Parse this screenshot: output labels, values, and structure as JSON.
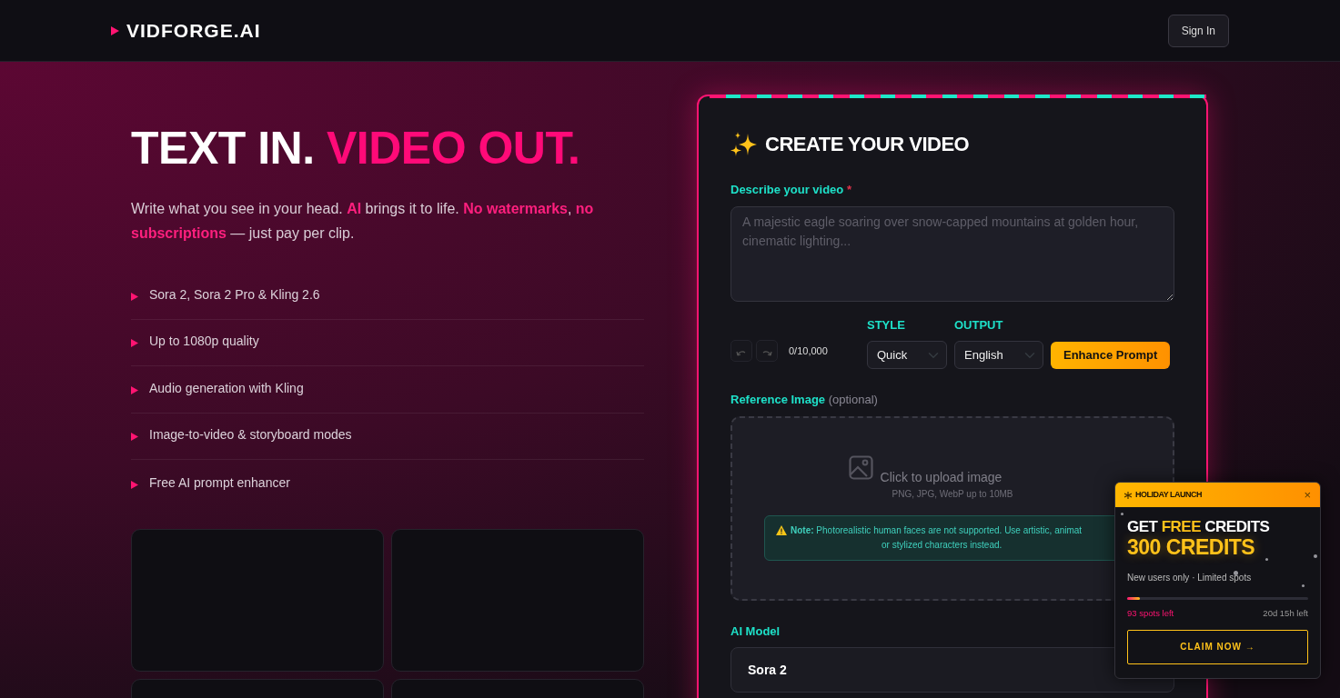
{
  "brand": {
    "name": "VIDFORGE.AI"
  },
  "nav": {
    "sign_in": "Sign In"
  },
  "hero": {
    "title_white": "TEXT IN.",
    "title_accent": "VIDEO OUT.",
    "intro": "Write what you see in your head. **AI** brings it to life. **No watermarks**, **no subscriptions** — just pay per clip.",
    "features": [
      "Sora 2, Sora 2 Pro & Kling 2.6",
      "Up to 1080p quality",
      "Audio generation with Kling",
      "Image-to-video & storyboard modes",
      "Free AI prompt enhancer"
    ]
  },
  "form": {
    "title": "CREATE YOUR VIDEO",
    "prompt_label": "Describe your video",
    "required_mark": "*",
    "prompt_placeholder": "A majestic eagle soaring over snow-capped mountains at golden hour, cinematic lighting...",
    "char_count": "0/10,000",
    "style": {
      "label": "STYLE",
      "value": "Quick"
    },
    "output": {
      "label": "OUTPUT",
      "value": "English"
    },
    "enhance_button": "Enhance Prompt",
    "reference_label": "Reference Image",
    "reference_hint": "(optional)",
    "upload_text": "Click to upload image",
    "upload_formats": "PNG, JPG, WebP up to 10MB",
    "note_label": "Note:",
    "note_lines": [
      "Photorealistic human faces are not supported. Use artistic, animat",
      "or stylized characters instead."
    ],
    "model_label": "AI Model",
    "model_value": "Sora 2"
  },
  "promo": {
    "header": "HOLIDAY LAUNCH",
    "close": "×",
    "headline_white_1": "GET",
    "headline_accent": "FREE",
    "headline_white_2": "CREDITS",
    "amount": "300 CREDITS",
    "subtitle": "New users only · Limited spots",
    "level": 0.07,
    "spots": "93 spots left",
    "time_left": "20d 15h left",
    "cta": "CLAIM NOW →"
  }
}
